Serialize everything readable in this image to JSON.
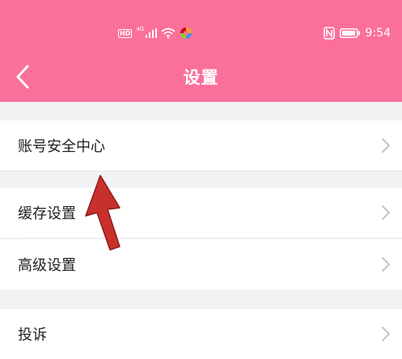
{
  "colors": {
    "header": "#fb6f9b",
    "background": "#f2f2f4",
    "row": "#ffffff",
    "chevron": "#c4c4c4",
    "annotation_arrow": "#c8302c"
  },
  "status_bar": {
    "hd": "HD",
    "network": "4G",
    "time": "9:54",
    "icons": [
      "hd-icon",
      "signal-icon",
      "wifi-icon",
      "colorful-app-icon",
      "nfc-icon",
      "battery-icon"
    ]
  },
  "header": {
    "title": "设置",
    "back_icon": "chevron-left-icon"
  },
  "settings": {
    "account_security": "账号安全中心",
    "cache_settings": "缓存设置",
    "advanced_settings": "高级设置",
    "complaint": "投诉"
  },
  "annotation": {
    "icon": "red-arrow-icon"
  }
}
